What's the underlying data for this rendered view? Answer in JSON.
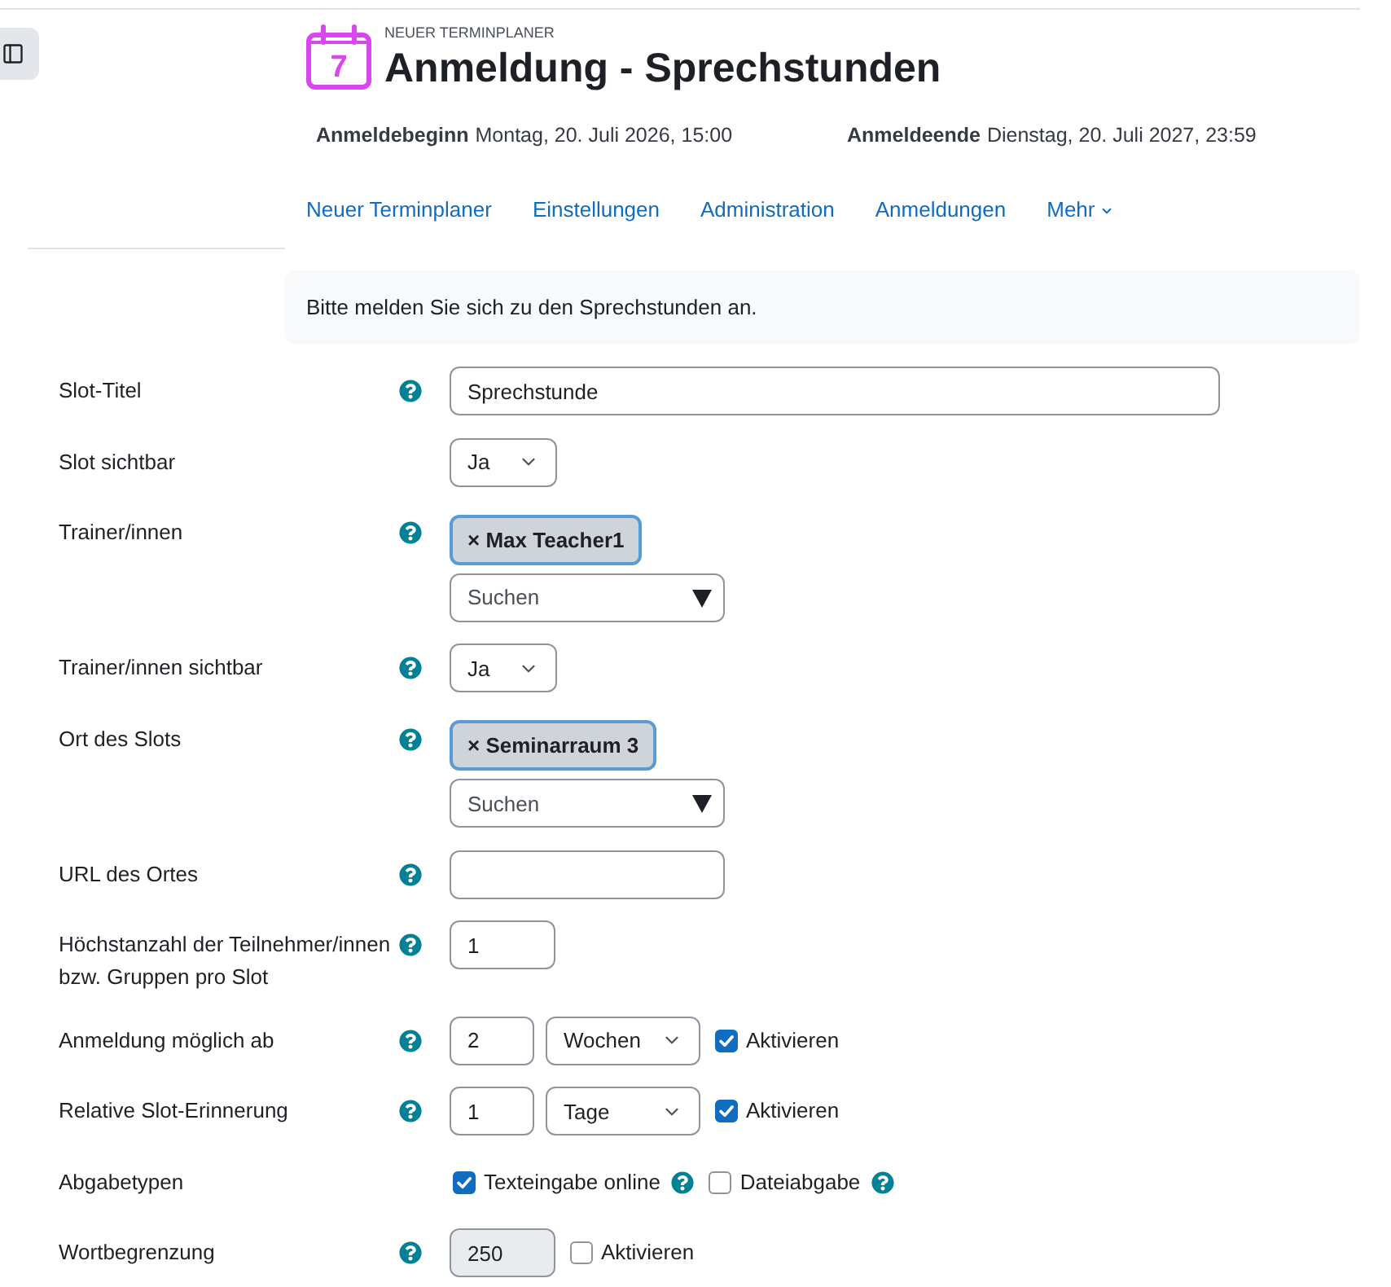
{
  "header": {
    "icon_day": "7",
    "overline": "NEUER TERMINPLANER",
    "title": "Anmeldung - Sprechstunden"
  },
  "dates": [
    {
      "label": "Anmeldebeginn",
      "value": "Montag, 20. Juli 2026, 15:00"
    },
    {
      "label": "Anmeldeende",
      "value": "Dienstag, 20. Juli 2027, 23:59"
    }
  ],
  "nav": [
    {
      "label": "Neuer Terminplaner",
      "dropdown": false
    },
    {
      "label": "Einstellungen",
      "dropdown": false
    },
    {
      "label": "Administration",
      "dropdown": false
    },
    {
      "label": "Anmeldungen",
      "dropdown": false
    },
    {
      "label": "Mehr",
      "dropdown": true
    }
  ],
  "intro": "Bitte melden Sie sich zu den Sprechstunden an.",
  "form": [
    {
      "label": "Slot-Titel",
      "help": true,
      "controls": [
        {
          "kind": "text",
          "value": "Sprechstunde"
        }
      ]
    },
    {
      "label": "Slot sichtbar",
      "help": false,
      "controls": [
        {
          "kind": "select",
          "value": "Ja"
        }
      ]
    },
    {
      "label": "Trainer/innen",
      "help": true,
      "controls": [
        {
          "kind": "tags",
          "tags": [
            {
              "remove": "×",
              "label": "Max Teacher1"
            }
          ],
          "placeholder": "Suchen"
        }
      ]
    },
    {
      "label": "Trainer/innen sichtbar",
      "help": true,
      "controls": [
        {
          "kind": "select",
          "value": "Ja"
        }
      ]
    },
    {
      "label": "Ort des Slots",
      "help": true,
      "controls": [
        {
          "kind": "tags",
          "tags": [
            {
              "remove": "×",
              "label": "Seminarraum 3"
            }
          ],
          "placeholder": "Suchen"
        }
      ]
    },
    {
      "label": "URL des Ortes",
      "help": true,
      "controls": [
        {
          "kind": "url"
        }
      ]
    },
    {
      "label": "Höchstanzahl der Teilnehmer/innen bzw. Gruppen pro Slot",
      "help": true,
      "controls": [
        {
          "kind": "number",
          "value": "1",
          "disabled": false
        }
      ]
    },
    {
      "label": "Anmeldung möglich ab",
      "help": true,
      "controls": [
        {
          "kind": "amount",
          "value": "2"
        },
        {
          "kind": "unit",
          "value": "Wochen"
        },
        {
          "kind": "checkbox",
          "label": "Aktivieren",
          "checked": true,
          "help": false
        }
      ]
    },
    {
      "label": "Relative Slot-Erinnerung",
      "help": true,
      "controls": [
        {
          "kind": "amount",
          "value": "1"
        },
        {
          "kind": "unit",
          "value": "Tage"
        },
        {
          "kind": "checkbox",
          "label": "Aktivieren",
          "checked": true,
          "help": false
        }
      ]
    },
    {
      "label": "Abgabetypen",
      "help": false,
      "controls": [
        {
          "kind": "checkbox",
          "label": "Texteingabe online",
          "checked": true,
          "help": true
        },
        {
          "kind": "checkbox",
          "label": "Dateiabgabe",
          "checked": false,
          "help": true
        }
      ]
    },
    {
      "label": "Wortbegrenzung",
      "help": true,
      "controls": [
        {
          "kind": "number",
          "value": "250",
          "disabled": true
        },
        {
          "kind": "checkbox",
          "label": "Aktivieren",
          "checked": false,
          "help": false
        }
      ]
    }
  ]
}
